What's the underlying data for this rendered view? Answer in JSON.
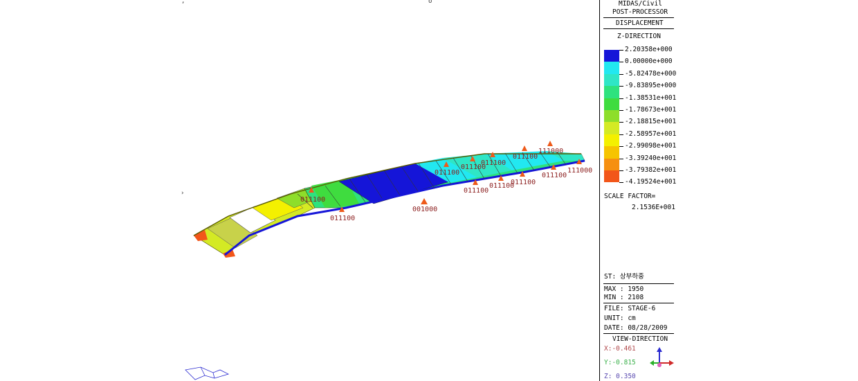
{
  "panel": {
    "program": "MIDAS/Civil",
    "mode": "POST-PROCESSOR",
    "result_type": "DISPLACEMENT",
    "component": "Z-DIRECTION",
    "legend": [
      {
        "value": "2.20358e+000",
        "color": "#1515d8"
      },
      {
        "value": "0.00000e+000",
        "color": "#22e8f0"
      },
      {
        "value": "-5.82478e+000",
        "color": "#2fe6c6"
      },
      {
        "value": "-9.83895e+000",
        "color": "#2ee27e"
      },
      {
        "value": "-1.38531e+001",
        "color": "#3fdc3f"
      },
      {
        "value": "-1.78673e+001",
        "color": "#8ede2a"
      },
      {
        "value": "-2.18815e+001",
        "color": "#d4ea24"
      },
      {
        "value": "-2.58957e+001",
        "color": "#f4f000"
      },
      {
        "value": "-2.99098e+001",
        "color": "#f6c400"
      },
      {
        "value": "-3.39240e+001",
        "color": "#f69010"
      },
      {
        "value": "-3.79382e+001",
        "color": "#f2561a"
      },
      {
        "value": "-4.19524e+001",
        "color": null
      }
    ],
    "scale_factor_label": "SCALE FACTOR=",
    "scale_factor_value": "2.1536E+001",
    "load_case": "ST: 상부하중",
    "max": "MAX : 1950",
    "min": "MIN : 2108",
    "file": "FILE: STAGE-6",
    "unit": "UNIT: cm",
    "date": "DATE: 08/28/2009",
    "view_direction_title": "VIEW-DIRECTION",
    "view_x": "X:-0.461",
    "view_y": "Y:-0.815",
    "view_z": "Z: 0.350",
    "view_colors": {
      "x": "#b0474a",
      "y": "#3ab04a",
      "z": "#5a4ab0"
    }
  },
  "supports": [
    {
      "label": "011100"
    },
    {
      "label": "011100"
    },
    {
      "label": "001000"
    },
    {
      "label": "011100"
    },
    {
      "label": "011100"
    },
    {
      "label": "011100"
    },
    {
      "label": "011100"
    },
    {
      "label": "011100"
    },
    {
      "label": "011100"
    },
    {
      "label": "011100"
    },
    {
      "label": "111000"
    },
    {
      "label": "111000"
    }
  ]
}
